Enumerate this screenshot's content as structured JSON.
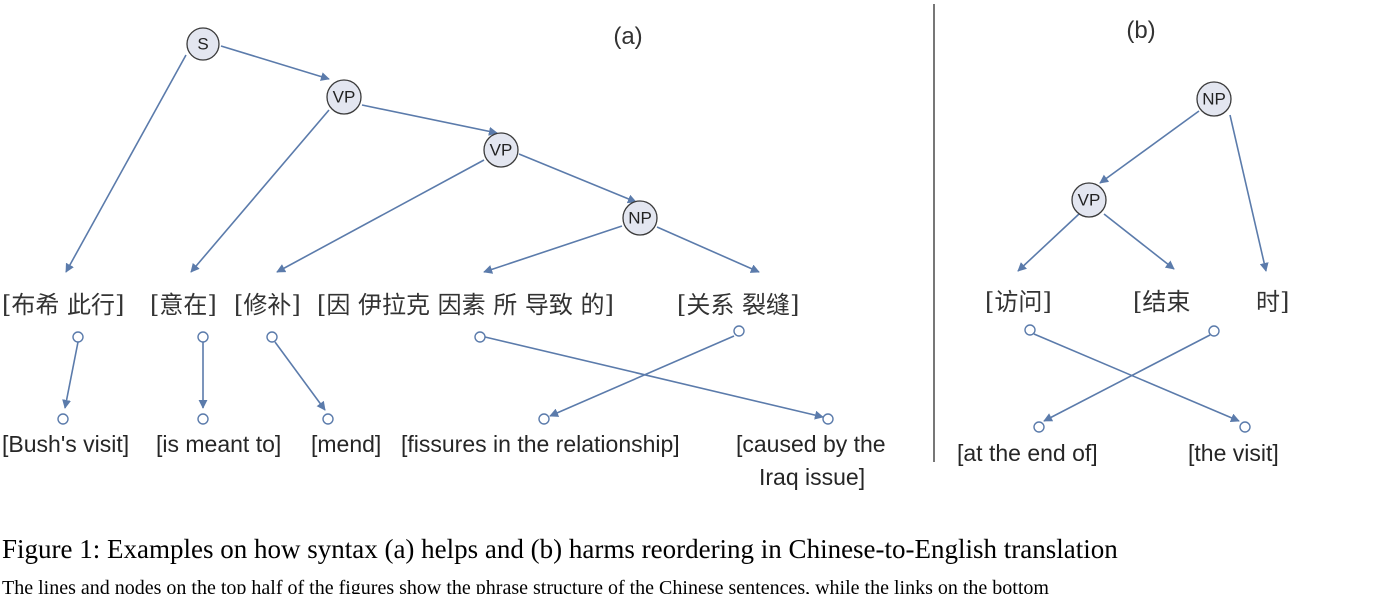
{
  "panels": {
    "a": {
      "label": "(a)",
      "nodes": [
        "S",
        "VP",
        "VP",
        "NP"
      ],
      "chinese_phrases": [
        "[布希 此行]",
        "[意在]",
        "[修补]",
        "[因 伊拉克 因素 所 导致 的]",
        "[关系 裂缝]"
      ],
      "english_phrases": [
        "[Bush's visit]",
        "[is meant to]",
        "[mend]",
        "[fissures in the relationship]",
        "[caused by the",
        "Iraq issue]"
      ]
    },
    "b": {
      "label": "(b)",
      "nodes": [
        "NP",
        "VP"
      ],
      "chinese_phrases": [
        "[访问]",
        "[结束",
        "时]"
      ],
      "english_phrases": [
        "[at the end of]",
        "[the visit]"
      ]
    }
  },
  "caption": {
    "title": "Figure 1: Examples on how syntax (a) helps and (b) harms reordering in Chinese-to-English translation",
    "body": "The lines and nodes on the top half of the figures show the phrase structure of the Chinese sentences, while the links on the bottom"
  }
}
